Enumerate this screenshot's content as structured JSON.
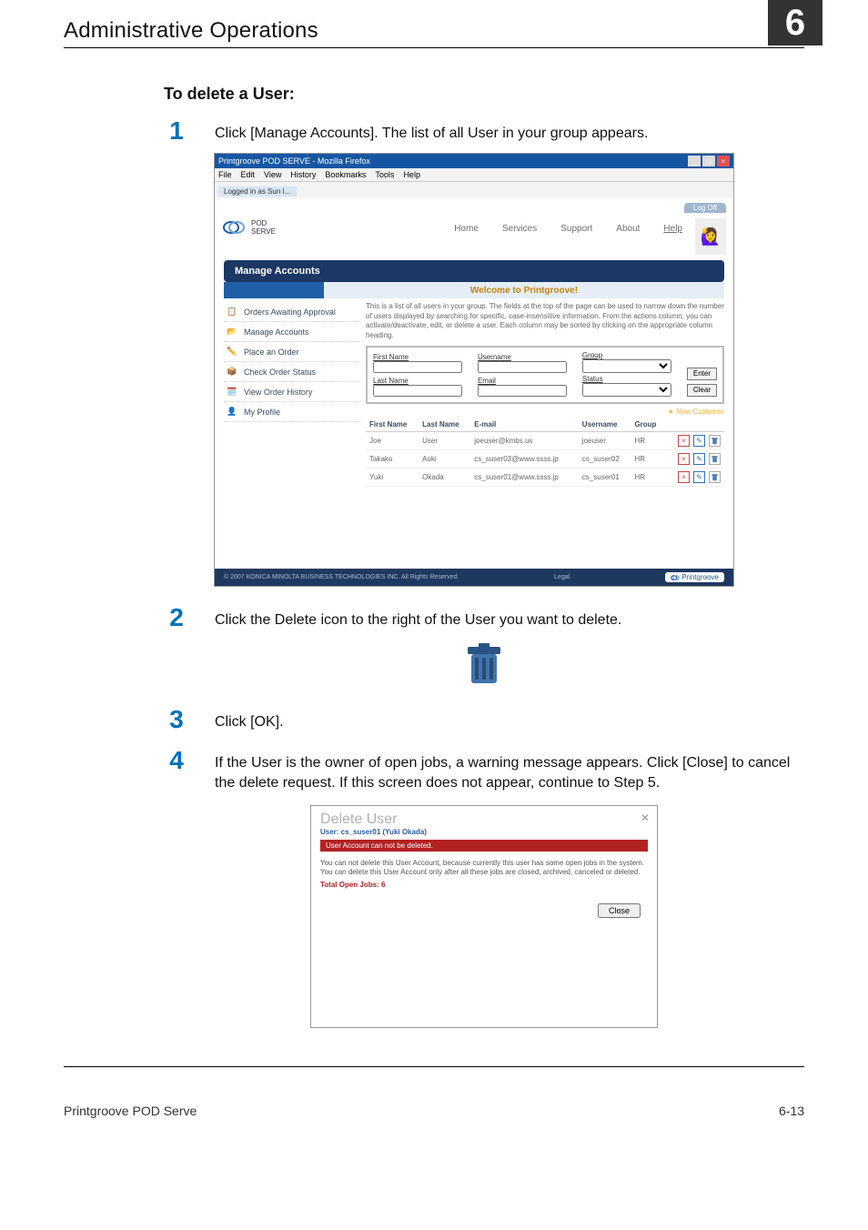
{
  "page_header": {
    "section_title": "Administrative Operations",
    "chapter_number": "6"
  },
  "subheading": "To delete a User:",
  "steps": {
    "s1": {
      "num": "1",
      "text": "Click [Manage Accounts]. The list of all User in your group appears."
    },
    "s2": {
      "num": "2",
      "text": "Click the Delete icon to the right of the User you want to delete."
    },
    "s3": {
      "num": "3",
      "text": "Click [OK]."
    },
    "s4": {
      "num": "4",
      "text": "If the User is the owner of open jobs, a warning message appears. Click [Close] to cancel the delete request. If this screen does not appear, continue to Step 5."
    }
  },
  "browser": {
    "title": "Printgroove POD SERVE - Mozilla Firefox",
    "menus": [
      "File",
      "Edit",
      "View",
      "History",
      "Bookmarks",
      "Tools",
      "Help"
    ],
    "tab": "Logged in as Sun l…",
    "nav": {
      "home": "Home",
      "services": "Services",
      "support": "Support",
      "about": "About",
      "help": "Help"
    },
    "logoff": "Log Off",
    "logo_text": "POD\nSERVE",
    "head_bar": "Manage Accounts",
    "welcome": "Welcome to Printgroove!",
    "sidebar": [
      {
        "icon": "📋",
        "label": "Orders Awaiting Approval"
      },
      {
        "icon": "📂",
        "label": "Manage Accounts"
      },
      {
        "icon": "✏️",
        "label": "Place an Order"
      },
      {
        "icon": "📦",
        "label": "Check Order Status"
      },
      {
        "icon": "🗓️",
        "label": "View Order History"
      },
      {
        "icon": "👤",
        "label": "My Profile"
      }
    ],
    "instructions": "This is a list of all users in your group. The fields at the top of the page can be used to narrow down the number of users displayed by searching for specific, case-insensitive information. From the actions column, you can activate/deactivate, edit, or delete a user. Each column may be sorted by clicking on the appropriate column heading.",
    "filter": {
      "first_name": "First Name",
      "last_name": "Last Name",
      "username": "Username",
      "email": "Email",
      "group": "Group",
      "status": "Status",
      "enter": "Enter",
      "clear": "Clear"
    },
    "new_customer": "New Customer",
    "table": {
      "headers": {
        "first": "First Name",
        "last": "Last Name",
        "email": "E-mail",
        "user": "Username",
        "group": "Group"
      },
      "rows": [
        {
          "first": "Joe",
          "last": "User",
          "email": "joeuser@kmbs.us",
          "user": "joeuser",
          "group": "HR"
        },
        {
          "first": "Takako",
          "last": "Aoki",
          "email": "cs_suser02@www.ssss.jp",
          "user": "cs_suser02",
          "group": "HR"
        },
        {
          "first": "Yuki",
          "last": "Okada",
          "email": "cs_suser01@www.ssss.jp",
          "user": "cs_suser01",
          "group": "HR"
        }
      ]
    },
    "footer_copy": "© 2007 KONICA MINOLTA BUSINESS TECHNOLOGIES INC. All Rights Reserved.",
    "footer_brand": "Printgroove"
  },
  "modal": {
    "title": "Delete User",
    "user_line": "User: cs_suser01 (Yuki Okada)",
    "error": "User Account can not be deleted.",
    "body": "You can not delete this User Account, because currently this user has some open jobs in the system. You can delete this User Account only after all these jobs are closed, archived, canceled or deleted.",
    "total": "Total Open Jobs: 6",
    "close": "Close"
  },
  "footer": {
    "left": "Printgroove POD Serve",
    "right": "6-13"
  }
}
